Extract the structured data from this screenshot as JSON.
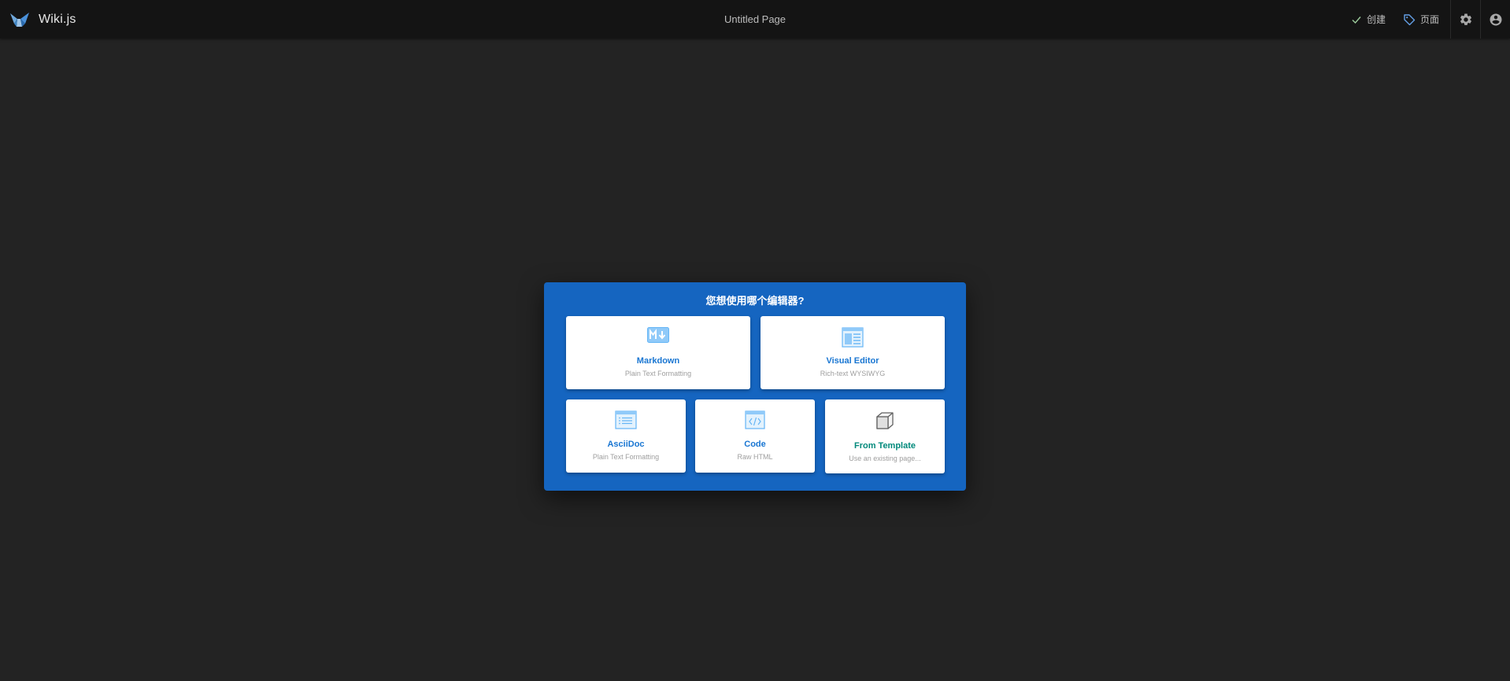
{
  "app": {
    "name": "Wiki.js",
    "page_title": "Untitled Page"
  },
  "toolbar": {
    "create_label": "创建",
    "page_label": "页面"
  },
  "dialog": {
    "title": "您想使用哪个编辑器?",
    "editors": [
      {
        "label": "Markdown",
        "sub": "Plain Text Formatting",
        "icon": "markdown-icon"
      },
      {
        "label": "Visual Editor",
        "sub": "Rich-text WYSIWYG",
        "icon": "visual-editor-icon"
      },
      {
        "label": "AsciiDoc",
        "sub": "Plain Text Formatting",
        "icon": "asciidoc-icon"
      },
      {
        "label": "Code",
        "sub": "Raw HTML",
        "icon": "code-icon"
      },
      {
        "label": "From Template",
        "sub": "Use an existing page...",
        "icon": "template-cube-icon"
      }
    ]
  },
  "colors": {
    "topbar_bg": "#141414",
    "page_bg": "#232323",
    "dialog_bg": "#1565c0",
    "accent_blue": "#1976d2",
    "accent_teal": "#00897b"
  }
}
